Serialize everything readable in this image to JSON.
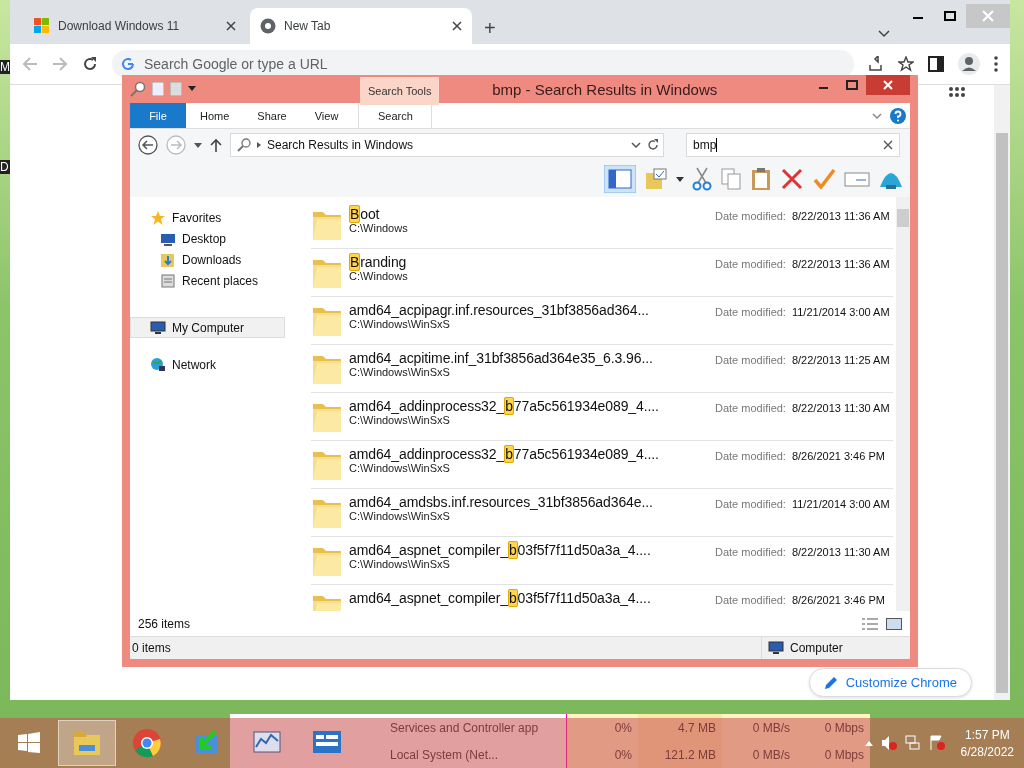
{
  "desktop_labels": [
    "M",
    "D"
  ],
  "browser": {
    "tabs": [
      {
        "title": "Download Windows 11",
        "selected": false
      },
      {
        "title": "New Tab",
        "selected": true
      }
    ],
    "new_tab": "+",
    "omnibox": {
      "placeholder": "Search Google or type a URL"
    },
    "customize_button": "Customize Chrome"
  },
  "explorer": {
    "title": "bmp - Search Results in Windows",
    "context_tab": "Search Tools",
    "ribbon_tabs": [
      {
        "label": "File",
        "kind": "file"
      },
      {
        "label": "Home",
        "kind": "tab"
      },
      {
        "label": "Share",
        "kind": "tab"
      },
      {
        "label": "View",
        "kind": "tab"
      },
      {
        "label": "Search",
        "kind": "context"
      }
    ],
    "address": "Search Results in Windows",
    "search": {
      "value": "bmp"
    },
    "nav": [
      {
        "label": "Favorites",
        "selected": false,
        "children": [
          {
            "label": "Desktop",
            "selected": false
          },
          {
            "label": "Downloads",
            "selected": false
          },
          {
            "label": "Recent places",
            "selected": false
          }
        ]
      },
      {
        "label": "My Computer",
        "selected": true
      },
      {
        "label": "Network",
        "selected": false
      }
    ],
    "files": [
      {
        "hit": "B",
        "post": "oot",
        "path": "C:\\Windows",
        "date_label": "Date modified:",
        "date": "8/22/2013 11:36 AM"
      },
      {
        "hit": "B",
        "post": "randing",
        "path": "C:\\Windows",
        "date_label": "Date modified:",
        "date": "8/22/2013 11:36 AM"
      },
      {
        "pre": "amd64_acpipagr.inf.resources_31bf3856ad364...",
        "path": "C:\\Windows\\WinSxS",
        "date_label": "Date modified:",
        "date": "11/21/2014 3:00 AM"
      },
      {
        "pre": "amd64_acpitime.inf_31bf3856ad364e35_6.3.96...",
        "path": "C:\\Windows\\WinSxS",
        "date_label": "Date modified:",
        "date": "8/22/2013 11:25 AM"
      },
      {
        "pre": "amd64_addinprocess32_",
        "hit": "b",
        "post": "77a5c561934e089_4....",
        "path": "C:\\Windows\\WinSxS",
        "date_label": "Date modified:",
        "date": "8/22/2013 11:30 AM"
      },
      {
        "pre": "amd64_addinprocess32_",
        "hit": "b",
        "post": "77a5c561934e089_4....",
        "path": "C:\\Windows\\WinSxS",
        "date_label": "Date modified:",
        "date": "8/26/2021 3:46 PM"
      },
      {
        "pre": "amd64_amdsbs.inf.resources_31bf3856ad364e...",
        "path": "C:\\Windows\\WinSxS",
        "date_label": "Date modified:",
        "date": "11/21/2014 3:00 AM"
      },
      {
        "pre": "amd64_aspnet_compiler_",
        "hit": "b",
        "post": "03f5f7f11d50a3a_4....",
        "path": "C:\\Windows\\WinSxS",
        "date_label": "Date modified:",
        "date": "8/22/2013 11:30 AM"
      },
      {
        "pre": "amd64_aspnet_compiler_",
        "hit": "b",
        "post": "03f5f7f11d50a3a_4....",
        "date_label": "Date modified:",
        "date": "8/26/2021 3:46 PM"
      }
    ],
    "item_count": "256 items",
    "selected_count": "0 items",
    "location": "Computer"
  },
  "task_manager": {
    "rows": [
      {
        "name": "Services and Controller app",
        "cpu": "0%",
        "memory": "4.7 MB",
        "disk": "0 MB/s",
        "network": "0 Mbps"
      },
      {
        "name": "Local System (Net...",
        "cpu": "0%",
        "memory": "121.2 MB",
        "disk": "0 MB/s",
        "network": "0 Mbps"
      }
    ]
  },
  "taskbar": {
    "apps": [
      {
        "kind": "explorer",
        "active": true
      },
      {
        "kind": "chrome",
        "active": false
      },
      {
        "kind": "installer",
        "active": false
      },
      {
        "kind": "monitor",
        "active": false
      },
      {
        "kind": "panel",
        "active": false
      }
    ],
    "time": "1:57 PM",
    "date": "6/28/2022"
  }
}
